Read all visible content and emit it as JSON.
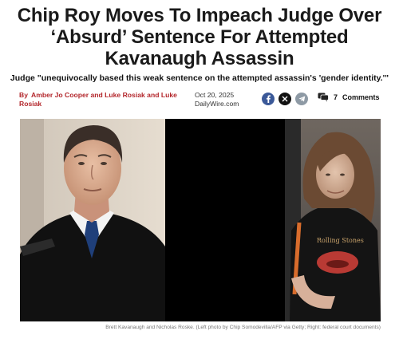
{
  "article": {
    "headline": "Chip Roy Moves To Impeach Judge Over ‘Absurd’ Sentence For Attempted Kavanaugh Assassin",
    "subhead": "Judge \"unequivocally based this weak sentence on the attempted assassin's 'gender identity.'\"",
    "byline_prefix": "By",
    "authors": "Amber Jo Cooper and Luke Rosiak and Luke Rosiak",
    "date": "Oct 20, 2025",
    "source": "DailyWire.com",
    "comments_count": "7",
    "comments_label": "Comments",
    "caption": "Brett Kavanaugh and Nicholas Roske. (Left photo by Chip Somodevilla/AFP via Getty; Right: federal court documents)"
  },
  "share": {
    "facebook_icon": "facebook-icon",
    "x_icon": "x-icon",
    "telegram_icon": "telegram-icon",
    "comment_icon": "comment-bubble-icon"
  },
  "colors": {
    "byline_red": "#b3262b",
    "facebook_blue": "#3b5998",
    "x_black": "#111111",
    "telegram_grey": "#8e9aa5"
  }
}
